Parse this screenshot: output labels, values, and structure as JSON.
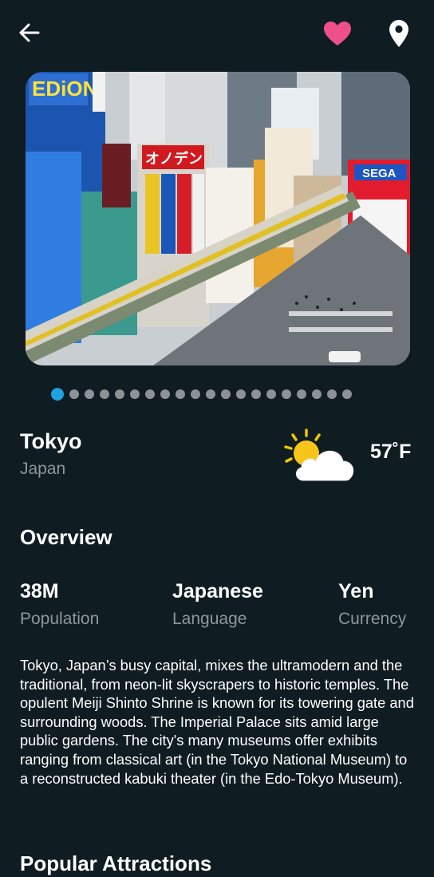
{
  "header": {
    "back_icon": "arrow-left-icon",
    "favorite_icon": "heart-icon",
    "favorite_color": "#f0508a",
    "location_icon": "map-pin-icon"
  },
  "gallery": {
    "image_subject": "Akihabara street scene with train",
    "total_images": 20,
    "active_index": 0,
    "active_dot_color": "#1ea2e0",
    "dot_color": "#8c9296"
  },
  "city": {
    "name": "Tokyo",
    "country": "Japan"
  },
  "weather": {
    "icon": "partly-sunny-icon",
    "temperature": "57˚F"
  },
  "overview": {
    "title": "Overview",
    "stats": [
      {
        "value": "38M",
        "label": "Population"
      },
      {
        "value": "Japanese",
        "label": "Language"
      },
      {
        "value": "Yen",
        "label": "Currency"
      }
    ],
    "description": "Tokyo, Japan’s busy capital, mixes the ultramodern and the traditional, from neon-lit skyscrapers to historic temples. The opulent Meiji Shinto Shrine is known for its towering gate and surrounding woods. The Imperial Palace sits amid large public gardens. The city's many museums offer exhibits ranging from classical art (in the Tokyo National Museum) to a reconstructed kabuki theater (in the Edo-Tokyo Museum)."
  },
  "attractions": {
    "title": "Popular Attractions"
  },
  "theme": {
    "background": "#0f1c22",
    "muted_text": "#8e979b"
  }
}
